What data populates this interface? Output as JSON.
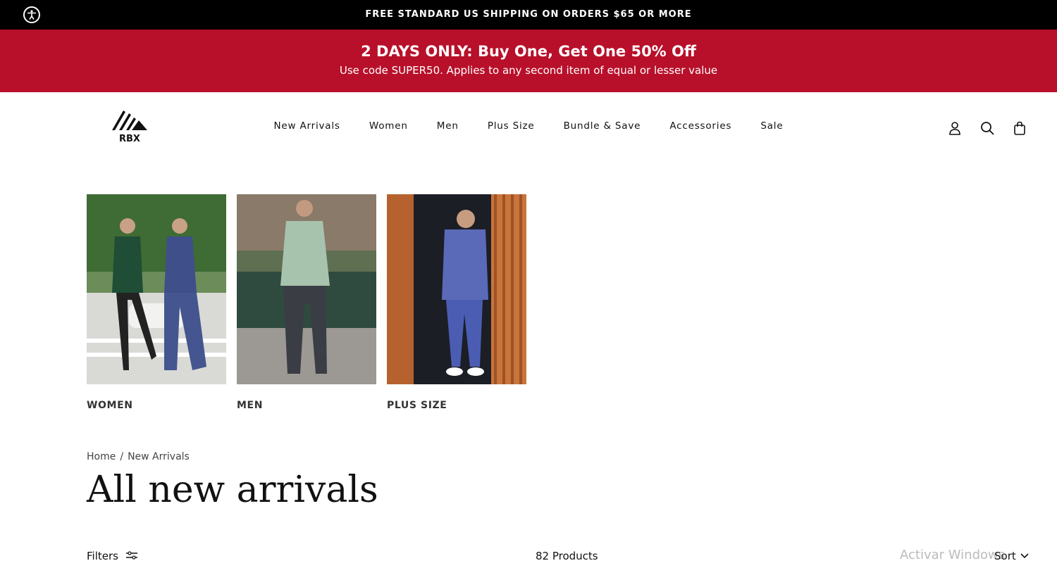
{
  "announcement": "FREE STANDARD US SHIPPING ON ORDERS $65 OR MORE",
  "promo": {
    "headline": "2 DAYS ONLY: Buy One, Get One 50% Off",
    "subtext": "Use code SUPER50. Applies to any second item of equal or lesser value"
  },
  "brand": "RBX",
  "nav": [
    "New Arrivals",
    "Women",
    "Men",
    "Plus Size",
    "Bundle & Save",
    "Accessories",
    "Sale"
  ],
  "header_icons": [
    "account-icon",
    "search-icon",
    "bag-icon"
  ],
  "categories": [
    {
      "label": "WOMEN"
    },
    {
      "label": "MEN"
    },
    {
      "label": "PLUS SIZE"
    }
  ],
  "breadcrumb": {
    "home": "Home",
    "sep": "/",
    "current": "New Arrivals"
  },
  "page_title": "All new arrivals",
  "toolbar": {
    "filters": "Filters",
    "count": "82 Products",
    "sort": "Sort"
  },
  "watermark": "Activar Windows",
  "colors": {
    "promo_bg": "#b8102a",
    "topbar_bg": "#000000"
  }
}
